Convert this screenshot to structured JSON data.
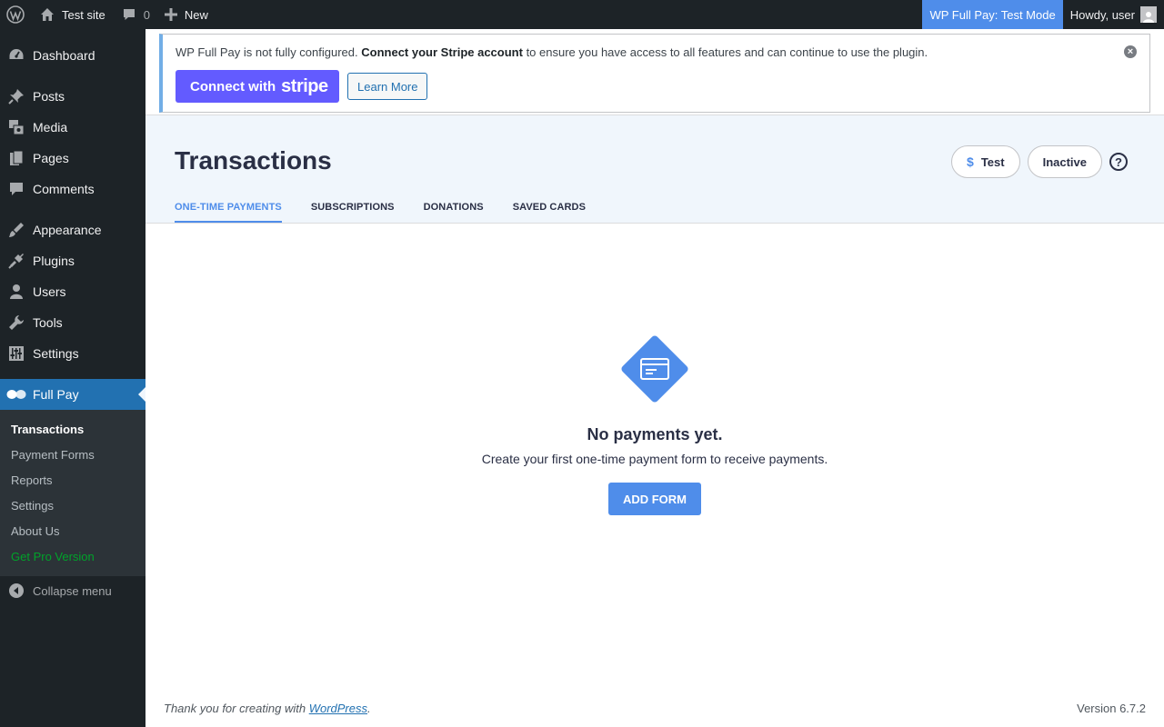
{
  "adminbar": {
    "site_name": "Test site",
    "comments_count": "0",
    "new_label": "New",
    "test_mode_label": "WP Full Pay: Test Mode",
    "howdy": "Howdy, user"
  },
  "sidebar": {
    "items": [
      {
        "label": "Dashboard",
        "icon": "dashboard-icon"
      },
      {
        "label": "Posts",
        "icon": "pin-icon"
      },
      {
        "label": "Media",
        "icon": "media-icon"
      },
      {
        "label": "Pages",
        "icon": "pages-icon"
      },
      {
        "label": "Comments",
        "icon": "comment-icon"
      },
      {
        "label": "Appearance",
        "icon": "paintbrush-icon"
      },
      {
        "label": "Plugins",
        "icon": "plug-icon"
      },
      {
        "label": "Users",
        "icon": "user-icon"
      },
      {
        "label": "Tools",
        "icon": "wrench-icon"
      },
      {
        "label": "Settings",
        "icon": "sliders-icon"
      },
      {
        "label": "Full Pay",
        "icon": "fullpay-logo-icon"
      }
    ],
    "submenu": [
      "Transactions",
      "Payment Forms",
      "Reports",
      "Settings",
      "About Us",
      "Get Pro Version"
    ],
    "collapse_label": "Collapse menu"
  },
  "notice": {
    "text_before": "WP Full Pay is not fully configured. ",
    "text_bold": "Connect your Stripe account",
    "text_after": " to ensure you have access to all features and can continue to use the plugin.",
    "connect_label": "Connect with",
    "stripe_word": "stripe",
    "learn_more": "Learn More"
  },
  "header": {
    "title": "Transactions",
    "test_pill": "Test",
    "inactive_pill": "Inactive",
    "help": "?",
    "tabs": [
      "ONE-TIME PAYMENTS",
      "SUBSCRIPTIONS",
      "DONATIONS",
      "SAVED CARDS"
    ]
  },
  "empty": {
    "title": "No payments yet.",
    "description": "Create your first one-time payment form to receive payments.",
    "button": "ADD FORM"
  },
  "footer": {
    "thanks_prefix": "Thank you for creating with ",
    "wordpress_link": "WordPress",
    "thanks_suffix": ".",
    "version": "Version 6.7.2"
  },
  "colors": {
    "accent": "#4f8dea",
    "admin_dark": "#1d2327",
    "wp_blue": "#2271b1",
    "stripe": "#635bff",
    "pro_green": "#00a32a"
  }
}
